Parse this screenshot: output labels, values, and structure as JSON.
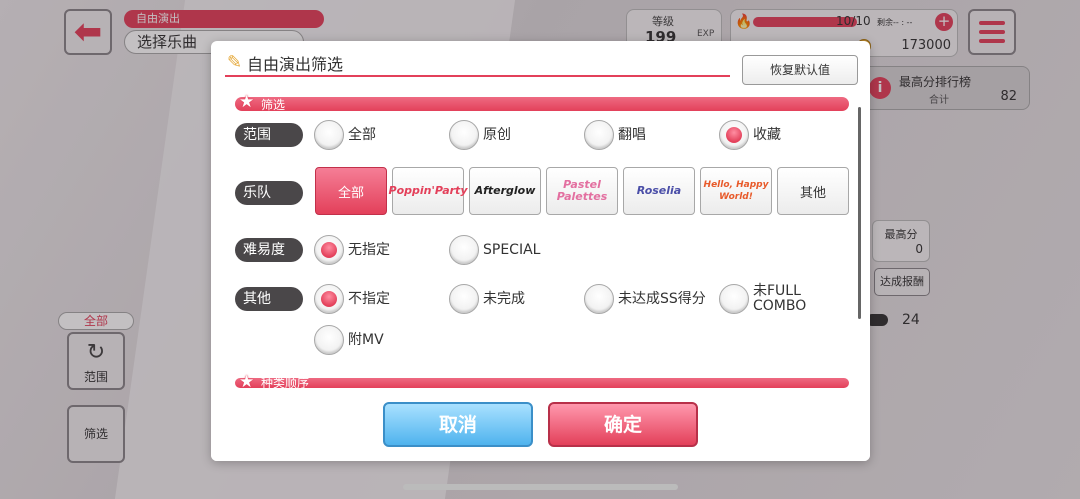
{
  "header": {
    "mode_tag": "自由演出",
    "screen_title": "选择乐曲",
    "level_label": "等级",
    "level_value": "199",
    "exp_label": "EXP",
    "stamina_count": "10/10",
    "stamina_fraction": 1.0,
    "stamina_rest": "剩余-- : --",
    "coins": "173000"
  },
  "right_panel": {
    "ranking_label": "最高分排行榜",
    "total_label": "合计",
    "total_value": "82",
    "best_score_label": "最高分",
    "best_score_value": "0",
    "achieve_button": "达成报酬",
    "count_value": "24"
  },
  "left_panel": {
    "scope_tag": "全部",
    "scope_button": "范围",
    "filter_button": "筛选"
  },
  "dialog": {
    "title": "自由演出筛选",
    "reset_button": "恢复默认值",
    "section_filter": "筛选",
    "section_sort": "种类顺序",
    "cancel_button": "取消",
    "ok_button": "确定",
    "rows": {
      "scope": {
        "label": "范围",
        "options": [
          "全部",
          "原创",
          "翻唱",
          "收藏"
        ],
        "selected": "收藏"
      },
      "band": {
        "label": "乐队",
        "options": [
          "全部",
          "Poppin'Party",
          "Afterglow",
          "Pastel Palettes",
          "Roselia",
          "Hello, Happy World!",
          "其他"
        ],
        "selected": "全部"
      },
      "difficulty": {
        "label": "难易度",
        "options": [
          "无指定",
          "SPECIAL"
        ],
        "selected": "无指定"
      },
      "other": {
        "label": "其他",
        "options": [
          "不指定",
          "未完成",
          "未达成SS得分",
          "未FULL COMBO",
          "附MV"
        ],
        "selected": "不指定"
      }
    }
  },
  "colors": {
    "accent": "#e3405a",
    "cancel_blue": "#4fb3ee",
    "label_dark": "#4a4749"
  }
}
